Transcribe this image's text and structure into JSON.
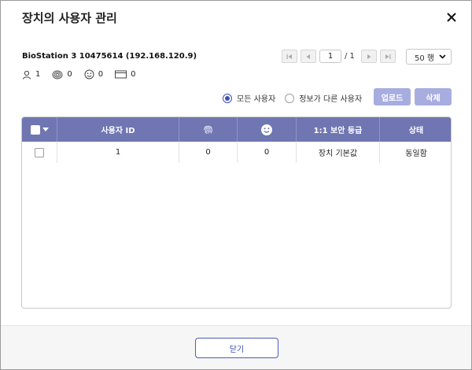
{
  "dialog": {
    "title": "장치의 사용자 관리"
  },
  "device": {
    "name": "BioStation 3 10475614 (192.168.120.9)"
  },
  "counts": {
    "users": "1",
    "fingerprints": "0",
    "faces": "0",
    "cards": "0"
  },
  "pagination": {
    "current_page": "1",
    "total_pages": "/ 1",
    "page_size": "50 행"
  },
  "filter": {
    "all_users": "모든 사용자",
    "different_users": "정보가 다른 사용자",
    "selected": "all_users"
  },
  "actions": {
    "upload": "업로드",
    "delete": "삭제"
  },
  "table": {
    "columns": [
      "사용자 ID",
      "fingerprint-icon",
      "face-icon",
      "1:1 보안 등급",
      "상태"
    ],
    "rows": [
      {
        "user_id": "1",
        "fingerprints": "0",
        "faces": "0",
        "security_level": "장치 기본값",
        "status": "동일함"
      }
    ]
  },
  "footer": {
    "close_label": "닫기"
  },
  "colors": {
    "accent": "#3a4fb8",
    "header_bg": "#6f76b2",
    "button_disabled": "#a8ade0"
  }
}
